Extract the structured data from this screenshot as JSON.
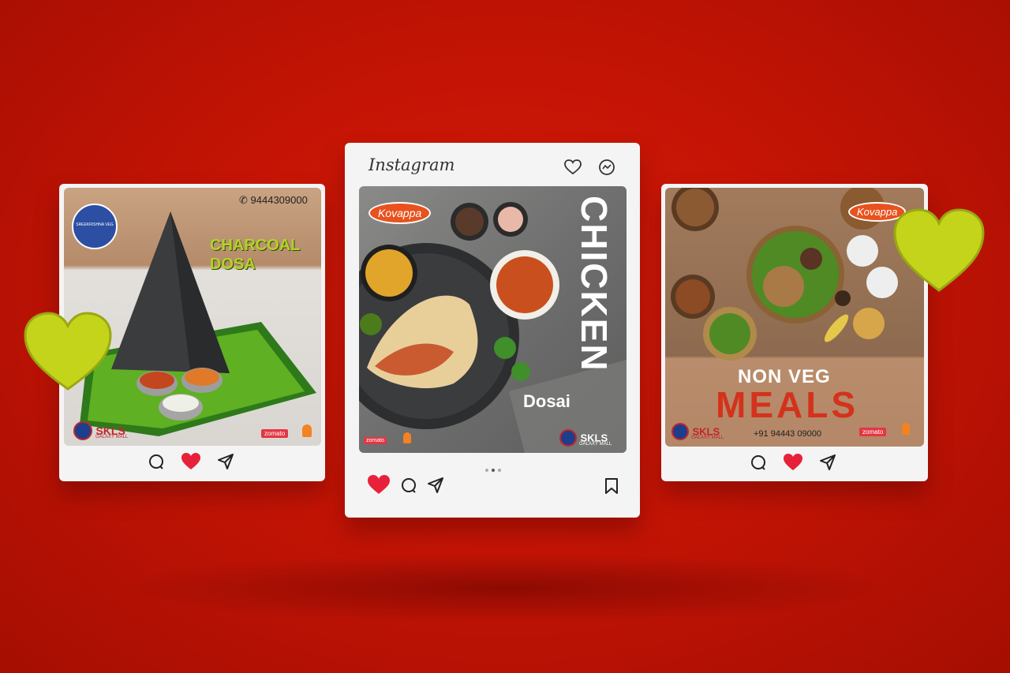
{
  "posts": {
    "left": {
      "phone": "9444309000",
      "brand_logo_text": "SREEKRISHNA VEG",
      "headline_line1": "CHARCOAL",
      "headline_line2": "DOSA",
      "sponsor": "SKLS",
      "sponsor_sub": "GALAXY MALL",
      "delivery_partner": "zomato",
      "liked": true
    },
    "center": {
      "app_name": "Instagram",
      "restaurant_logo": "Kovappa",
      "headline_vertical": "CHICKEN",
      "headline_small": "Dosai",
      "sponsor": "SKLS",
      "sponsor_sub": "GALAXY MALL",
      "delivery_partner": "zomato",
      "liked": true
    },
    "right": {
      "restaurant_logo": "Kovappa",
      "headline_line1": "NON VEG",
      "headline_line2": "MEALS",
      "phone": "+91 94443 09000",
      "sponsor": "SKLS",
      "sponsor_sub": "GALAXY MALL",
      "delivery_partner": "zomato",
      "liked": true
    }
  },
  "colors": {
    "background": "#c41405",
    "like_red": "#e8213a",
    "heart_yellow": "#c4d41a",
    "headline_green": "#b5d12a",
    "meals_red": "#d4321c"
  }
}
